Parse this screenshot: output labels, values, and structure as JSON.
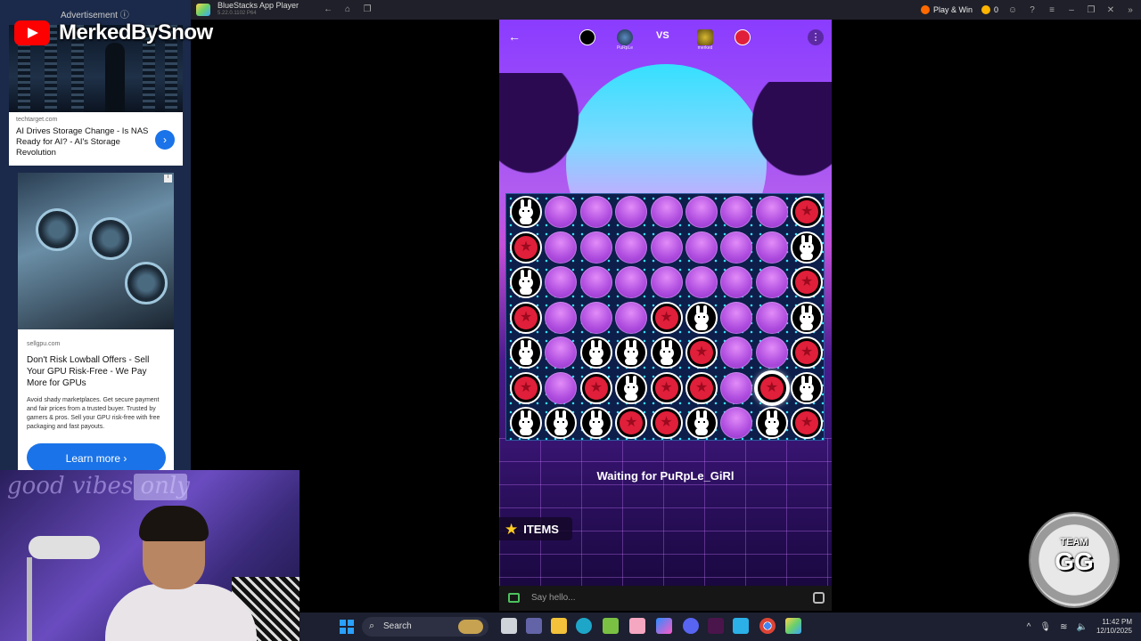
{
  "titlebar": {
    "app_name": "BlueStacks App Player",
    "version": "5.22.0.1102 P64",
    "play_win": "Play & Win",
    "coins": "0",
    "icons": [
      "back-icon",
      "home-icon",
      "multi-instance-icon",
      "coin-icon",
      "avatar-icon",
      "help-icon",
      "menu-icon",
      "minimize-icon",
      "restore-icon",
      "close-icon",
      "sidebar-toggle-icon"
    ]
  },
  "overlay": {
    "channel_name": "MerkedBySnow",
    "ad_label": "Advertisement ⓘ",
    "team_badge_line1": "TEAM",
    "team_badge_line2": "GG",
    "webcam_neon": "good vibes only"
  },
  "ads": [
    {
      "source": "techtarget.com",
      "headline": "AI Drives Storage Change - Is NAS Ready for AI? - AI's Storage Revolution"
    },
    {
      "source": "sellgpu.com",
      "headline": "Don't Risk Lowball Offers - Sell Your GPU Risk-Free - We Pay More for GPUs",
      "description": "Avoid shady marketplaces. Get secure payment and fair prices from a trusted buyer. Trusted by gamers & pros. Sell your GPU risk-free with free packaging and fast payouts.",
      "cta": "Learn more"
    }
  ],
  "game": {
    "player1_name": "PuRpLe",
    "vs": "VS",
    "player2_name": "merked",
    "waiting_text": "Waiting for PuRpLe_GiRl",
    "items_label": "ITEMS",
    "chat_placeholder": "Say hello...",
    "board": [
      [
        "bunny",
        "empty",
        "empty",
        "empty",
        "empty",
        "empty",
        "empty",
        "empty",
        "red"
      ],
      [
        "red",
        "empty",
        "empty",
        "empty",
        "empty",
        "empty",
        "empty",
        "empty",
        "bunny"
      ],
      [
        "bunny",
        "empty",
        "empty",
        "empty",
        "empty",
        "empty",
        "empty",
        "empty",
        "red"
      ],
      [
        "red",
        "empty",
        "empty",
        "empty",
        "red",
        "bunny",
        "empty",
        "empty",
        "bunny"
      ],
      [
        "bunny",
        "empty",
        "bunny",
        "bunny",
        "bunny",
        "red",
        "empty",
        "empty",
        "red"
      ],
      [
        "red",
        "empty",
        "red",
        "bunny",
        "red",
        "red",
        "empty",
        "red-last",
        "bunny"
      ],
      [
        "bunny",
        "bunny",
        "bunny",
        "red",
        "red",
        "bunny",
        "empty",
        "bunny",
        "red"
      ]
    ],
    "colors": {
      "red_piece": "#e01f3a",
      "board_bg": "#0d1e4a",
      "accent": "#8a3cff"
    }
  },
  "taskbar": {
    "search_label": "Search",
    "time": "11:42 PM",
    "date": "12/10/2025",
    "apps": [
      "file-explorer-icon",
      "edge-icon",
      "store-icon",
      "mail-icon",
      "photos-icon",
      "discord-icon",
      "teams-icon",
      "calendar-icon",
      "chrome-icon",
      "bluestacks-icon"
    ]
  }
}
